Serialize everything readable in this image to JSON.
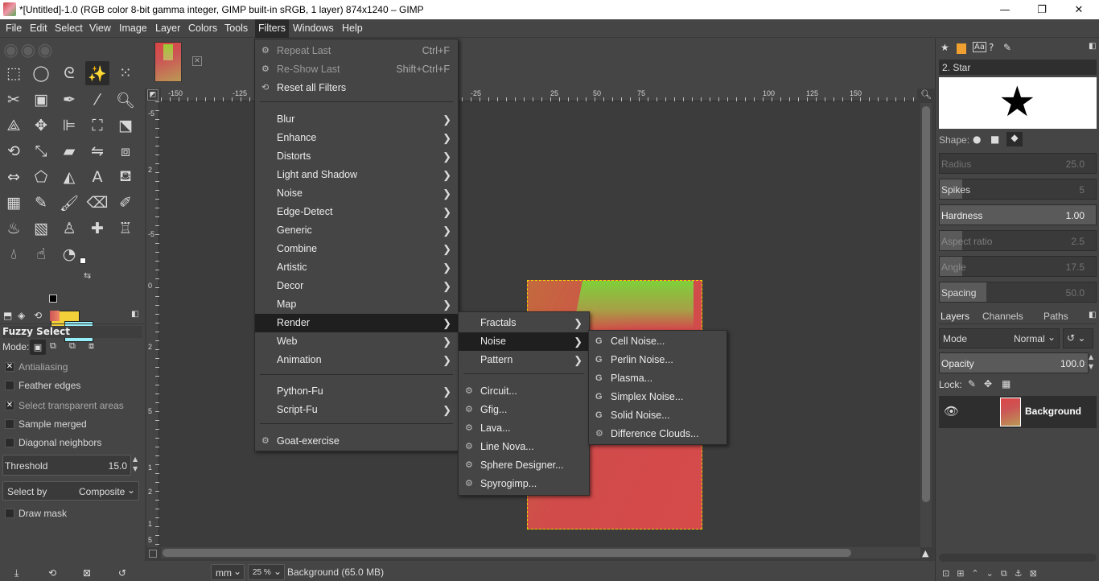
{
  "window": {
    "title": "*[Untitled]-1.0 (RGB color 8-bit gamma integer, GIMP built-in sRGB, 1 layer) 874x1240 – GIMP",
    "minimize": "—",
    "maximize": "❐",
    "close": "✕"
  },
  "menubar": [
    "File",
    "Edit",
    "Select",
    "View",
    "Image",
    "Layer",
    "Colors",
    "Tools",
    "Filters",
    "Windows",
    "Help"
  ],
  "filters_menu": {
    "top": [
      {
        "label": "Repeat Last",
        "accel": "Ctrl+F",
        "enabled": false
      },
      {
        "label": "Re-Show Last",
        "accel": "Shift+Ctrl+F",
        "enabled": false
      },
      {
        "label": "Reset all Filters",
        "accel": "",
        "enabled": true
      }
    ],
    "groups": [
      "Blur",
      "Enhance",
      "Distorts",
      "Light and Shadow",
      "Noise",
      "Edge-Detect",
      "Generic",
      "Combine",
      "Artistic",
      "Decor",
      "Map",
      "Render",
      "Web",
      "Animation"
    ],
    "scripts": [
      "Python-Fu",
      "Script-Fu"
    ],
    "extra": [
      "Goat-exercise"
    ],
    "highlighted": "Render"
  },
  "render_menu": {
    "submenus": [
      "Fractals",
      "Noise",
      "Pattern"
    ],
    "items": [
      "Circuit...",
      "Gfig...",
      "Lava...",
      "Line Nova...",
      "Sphere Designer...",
      "Spyrogimp..."
    ],
    "highlighted": "Noise"
  },
  "noise_menu": {
    "items": [
      "Cell Noise...",
      "Perlin Noise...",
      "Plasma...",
      "Simplex Noise...",
      "Solid Noise...",
      "Difference Clouds..."
    ]
  },
  "tool_options": {
    "title": "Fuzzy Select",
    "mode_label": "Mode:",
    "options": [
      {
        "label": "Antialiasing",
        "checked": true,
        "dim": true
      },
      {
        "label": "Feather edges",
        "checked": false,
        "dim": false
      },
      {
        "label": "Select transparent areas",
        "checked": true,
        "dim": true
      },
      {
        "label": "Sample merged",
        "checked": false,
        "dim": false
      },
      {
        "label": "Diagonal neighbors",
        "checked": false,
        "dim": false
      }
    ],
    "threshold_label": "Threshold",
    "threshold_value": "15.0",
    "select_by_label": "Select by",
    "select_by_value": "Composite",
    "draw_mask": "Draw mask"
  },
  "rulers": {
    "h": [
      "-150",
      "-125",
      "-25",
      "25",
      "50",
      "75",
      "100",
      "125",
      "150"
    ],
    "v": [
      "-5",
      "2",
      "-5",
      "0",
      "2",
      "5",
      "1",
      "2",
      "1",
      "5"
    ]
  },
  "statusbar": {
    "unit": "mm",
    "zoom": "25 %",
    "info": "Background (65.0 MB)"
  },
  "brushes": {
    "brush_name": "2. Star",
    "shape_label": "Shape:",
    "params": [
      {
        "label": "Radius",
        "value": "25.0",
        "dim": true
      },
      {
        "label": "Spikes",
        "value": "5",
        "dim": false
      },
      {
        "label": "Hardness",
        "value": "1.00",
        "dim": false
      },
      {
        "label": "Aspect ratio",
        "value": "2.5",
        "dim": true
      },
      {
        "label": "Angle",
        "value": "17.5",
        "dim": true
      },
      {
        "label": "Spacing",
        "value": "50.0",
        "dim": false
      }
    ]
  },
  "layers": {
    "tabs": [
      "Layers",
      "Channels",
      "Paths"
    ],
    "mode_label": "Mode",
    "mode_value": "Normal",
    "opacity_label": "Opacity",
    "opacity_value": "100.0",
    "lock_label": "Lock:",
    "layer_name": "Background"
  },
  "colors": {
    "fg": "#f2d03a",
    "bg": "#95eef9",
    "selection": "#e8d200"
  }
}
